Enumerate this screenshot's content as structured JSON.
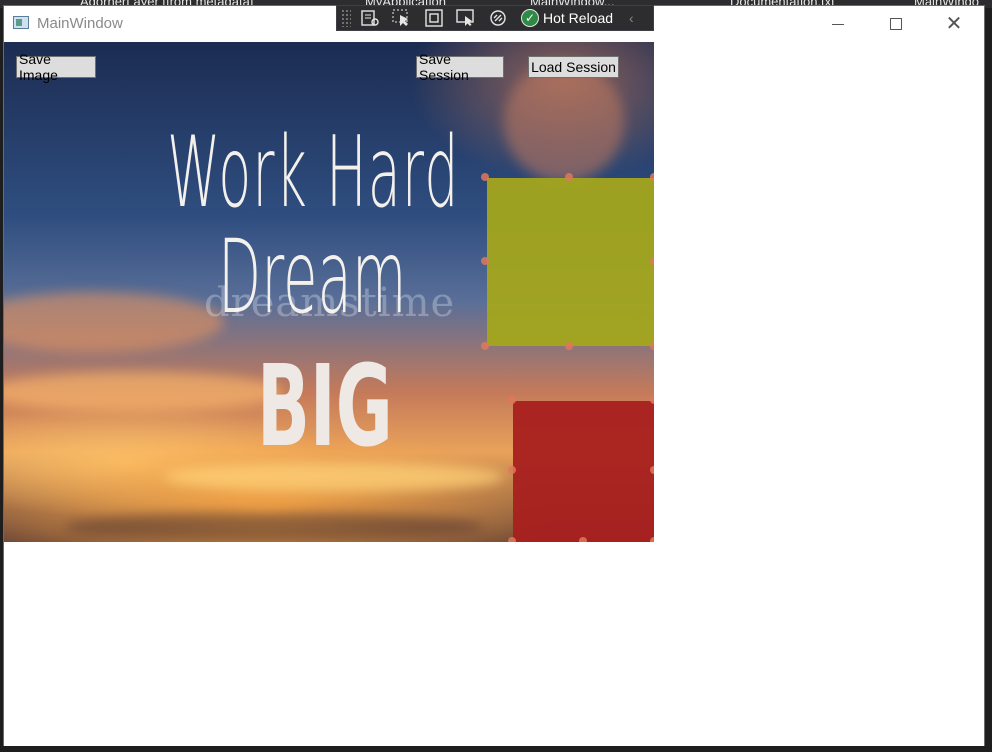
{
  "ide": {
    "tabs": [
      "AdornerLayer [from metadata]",
      "MyApplication",
      "MainWindow...",
      "Documentation.txt",
      "MainWindo"
    ]
  },
  "window": {
    "title": "MainWindow",
    "minimize_glyph": "—",
    "close_glyph": "✕"
  },
  "hot_reload_toolbar": {
    "label": "Hot Reload",
    "check_glyph": "✓",
    "collapse_glyph": "‹",
    "icons": [
      "go-to-live-visual-tree-icon",
      "select-element-icon",
      "display-layout-adorners-icon",
      "track-focused-element-icon",
      "binding-failures-icon"
    ]
  },
  "toolbar": {
    "save_image": "Save Image",
    "save_session": "Save Session",
    "load_session": "Load Session"
  },
  "poster": {
    "line1": "Work Hard",
    "line2": "Dream",
    "line3": "BIG",
    "watermark": "dreamstime"
  },
  "shapes": [
    {
      "name": "yellow-rectangle",
      "color": "#a3a51c"
    },
    {
      "name": "red-rectangle",
      "color": "#a8201f"
    }
  ],
  "colors": {
    "handle": "#e0785a",
    "button_bg": "#dddddd",
    "toolbar_bg": "#2d2d30"
  }
}
